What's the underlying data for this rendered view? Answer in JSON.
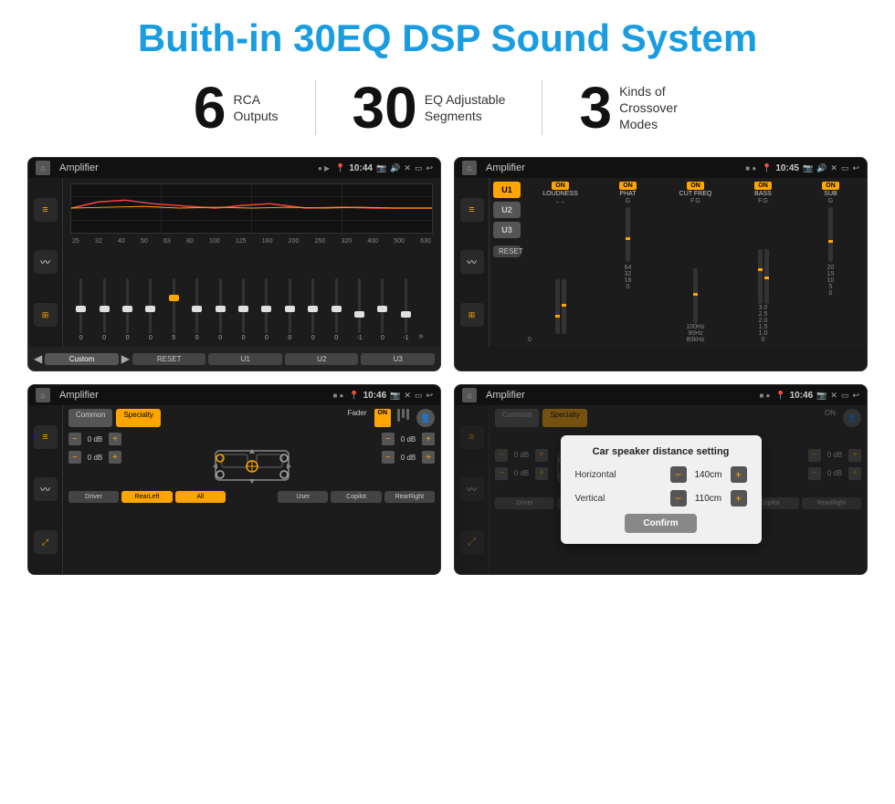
{
  "title": "Buith-in 30EQ DSP Sound System",
  "stats": [
    {
      "number": "6",
      "label": "RCA\nOutputs"
    },
    {
      "number": "30",
      "label": "EQ Adjustable\nSegments"
    },
    {
      "number": "3",
      "label": "Kinds of\nCrossover Modes"
    }
  ],
  "screens": [
    {
      "id": "screen1",
      "statusBar": {
        "title": "Amplifier",
        "time": "10:44"
      },
      "freqLabels": [
        "25",
        "32",
        "40",
        "50",
        "63",
        "80",
        "100",
        "125",
        "160",
        "200",
        "250",
        "320",
        "400",
        "500",
        "630"
      ],
      "sliderValues": [
        "0",
        "0",
        "0",
        "0",
        "5",
        "0",
        "0",
        "0",
        "0",
        "0",
        "0",
        "0",
        "-1",
        "0",
        "-1"
      ],
      "bottomButtons": [
        "Custom",
        "RESET",
        "U1",
        "U2",
        "U3"
      ]
    },
    {
      "id": "screen2",
      "statusBar": {
        "title": "Amplifier",
        "time": "10:45"
      },
      "uButtons": [
        "U1",
        "U2",
        "U3"
      ],
      "channels": [
        {
          "name": "LOUDNESS",
          "on": true
        },
        {
          "name": "PHAT",
          "on": true
        },
        {
          "name": "CUT FREQ",
          "on": true
        },
        {
          "name": "BASS",
          "on": true
        },
        {
          "name": "SUB",
          "on": true
        }
      ],
      "resetLabel": "RESET"
    },
    {
      "id": "screen3",
      "statusBar": {
        "title": "Amplifier",
        "time": "10:46"
      },
      "tabs": [
        "Common",
        "Specialty"
      ],
      "faderLabel": "Fader",
      "faderOn": "ON",
      "dbControls": [
        {
          "value": "0 dB"
        },
        {
          "value": "0 dB"
        },
        {
          "value": "0 dB"
        },
        {
          "value": "0 dB"
        }
      ],
      "bottomButtons": [
        "Driver",
        "RearLeft",
        "All",
        "User",
        "Copilot",
        "RearRight"
      ]
    },
    {
      "id": "screen4",
      "statusBar": {
        "title": "Amplifier",
        "time": "10:46"
      },
      "dialog": {
        "title": "Car speaker distance setting",
        "horizontalLabel": "Horizontal",
        "horizontalValue": "140cm",
        "verticalLabel": "Vertical",
        "verticalValue": "110cm",
        "confirmLabel": "Confirm"
      }
    }
  ]
}
